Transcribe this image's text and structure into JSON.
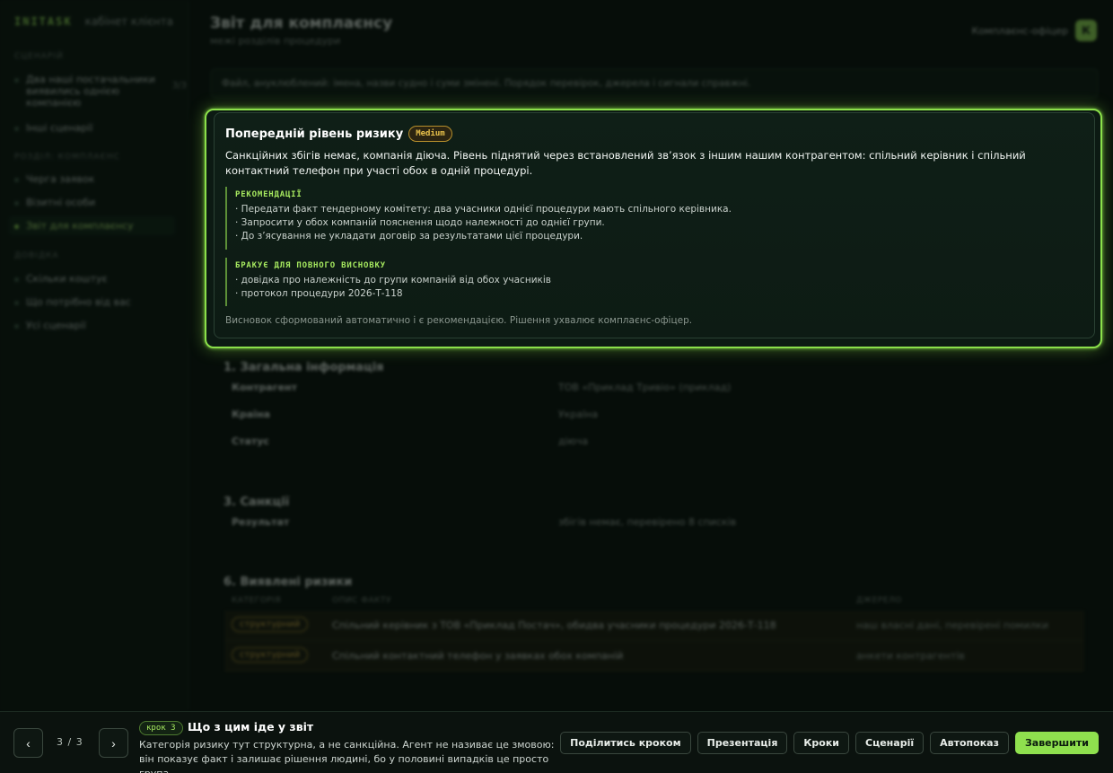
{
  "sidebar": {
    "logo": "INITASK",
    "subtitle": "кабінет клієнта",
    "section_scenario": "Сценарій",
    "scenario_items": [
      {
        "label": "Два наші постачальники виявились однією компанією",
        "count": "3/3"
      },
      {
        "label": "Інші сценарії"
      }
    ],
    "section_compliance": "Розділ: Комплаєнс",
    "compliance_items": [
      {
        "label": "Черга заявок"
      },
      {
        "label": "Візитні особи"
      },
      {
        "label": "Звіт для комплаєнсу"
      }
    ],
    "section_help": "Довідка",
    "help_items": [
      {
        "label": "Скільки коштує"
      },
      {
        "label": "Що потрібно від вас"
      },
      {
        "label": "Усі сценарії"
      }
    ]
  },
  "header": {
    "title": "Звіт для комплаєнсу",
    "subtitle": "межі розділів процедури",
    "officer": "Комплаєнс-офіцер",
    "avatar": "К"
  },
  "hint": "Файл, ануклюблений: імена, назви судно і суми змінені. Порядок перевірок, джерела і сигнали справжні.",
  "card": {
    "title": "Попередній рівень ризику",
    "risk_level": "Medium",
    "summary": "Санкційних збігів немає, компанія діюча. Рівень піднятий через встановлений зв’язок з іншим нашим контрагентом: спільний керівник і спільний контактний телефон при участі обох в одній процедурі.",
    "recommendations_label": "РЕКОМЕНДАЦІЇ",
    "recommendations": [
      "· Передати факт тендерному комітету: два учасники однієї процедури мають спільного керівника.",
      "· Запросити у обох компаній пояснення щодо належності до однієї групи.",
      "· До з’ясування не укладати договір за результатами цієї процедури."
    ],
    "missing_label": "БРАКУЄ ДЛЯ ПОВНОГО ВИСНОВКУ",
    "missing": [
      "· довідка про належність до групи компаній від обох учасників",
      "· протокол процедури 2026-Т-118"
    ],
    "footer": "Висновок сформований автоматично і є рекомендацією. Рішення ухвалює комплаєнс-офіцер."
  },
  "general": {
    "title": "1. Загальна інформація",
    "rows": [
      {
        "k": "Контрагент",
        "v": "ТОВ «Приклад Тривіо» (приклад)"
      },
      {
        "k": "Країна",
        "v": "Україна"
      },
      {
        "k": "Статус",
        "v": "діюча"
      }
    ]
  },
  "sanctions": {
    "title": "3. Санкції",
    "rows": [
      {
        "k": "Результат",
        "v": "збігів немає, перевірено 8 списків"
      }
    ]
  },
  "risks": {
    "title": "6. Виявлені ризики",
    "headers": [
      "КАТЕГОРІЯ",
      "ОПИС ФАКТУ",
      "ДЖЕРЕЛО"
    ],
    "rows": [
      {
        "category": "структурний",
        "desc": "Спільний керівник з ТОВ «Приклад Постач», обидва учасники процедури 2026-Т-118",
        "source": "наш власні дані, перевірені помилки"
      },
      {
        "category": "структурний",
        "desc": "Спільний контактний телефон у заявках обох компаній",
        "source": "анкети контрагентів"
      }
    ]
  },
  "tour": {
    "prev": "‹",
    "next": "›",
    "counter": "3 / 3",
    "step": "крок 3",
    "title": "Що з цим іде у звіт",
    "desc": "Категорія ризику тут структурна, а не санкційна. Агент не називає це змовою: він показує факт і залишає рішення людині, бо у половині випадків це просто група...",
    "actions": [
      "Поділитись кроком",
      "Презентація",
      "Кроки",
      "Сценарії",
      "Автопоказ"
    ],
    "finish": "Завершити"
  },
  "colors": {
    "accent": "#8fe04e",
    "medium": "#e8c14b",
    "background": "#060d09"
  }
}
